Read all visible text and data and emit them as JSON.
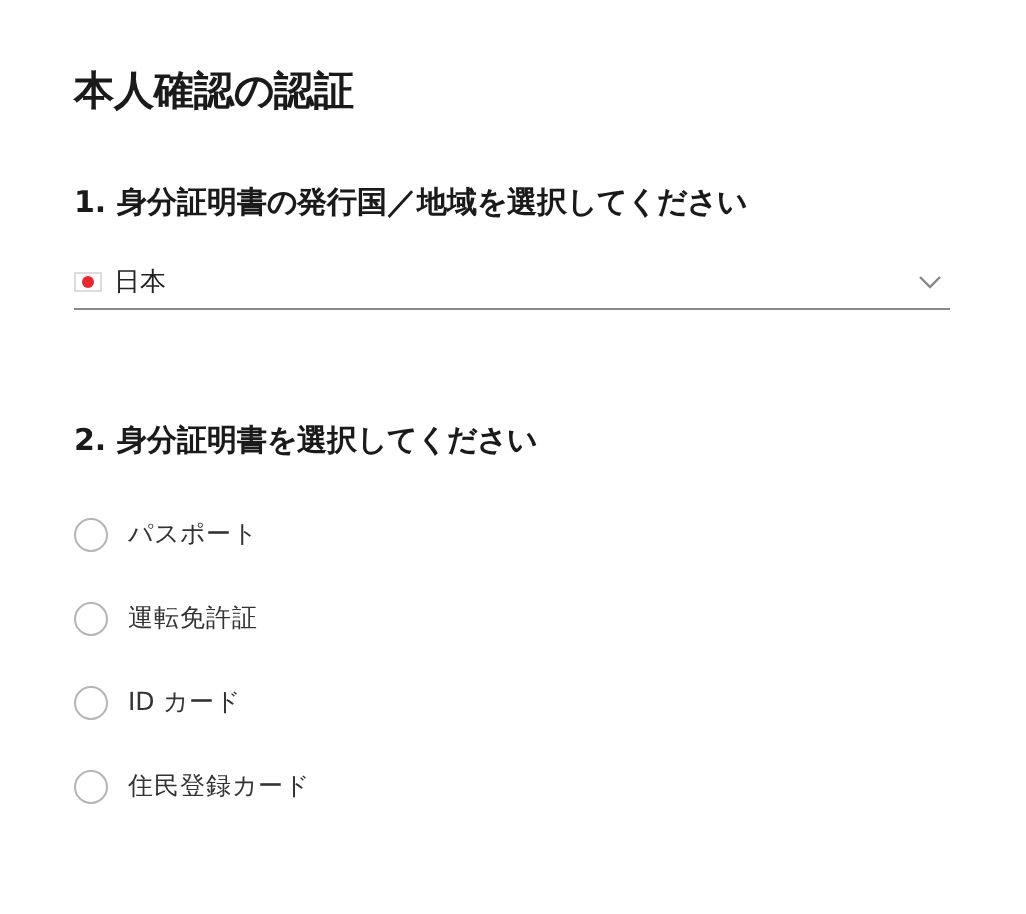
{
  "title": "本人確認の認証",
  "country_section": {
    "heading": "1. 身分証明書の発行国／地域を選択してください",
    "select": {
      "value": "日本"
    }
  },
  "document_section": {
    "heading": "2. 身分証明書を選択してください",
    "options": [
      {
        "label": "パスポート",
        "selected": false
      },
      {
        "label": "運転免許証",
        "selected": false
      },
      {
        "label": "ID カード",
        "selected": false
      },
      {
        "label": "住民登録カード",
        "selected": false
      }
    ]
  }
}
